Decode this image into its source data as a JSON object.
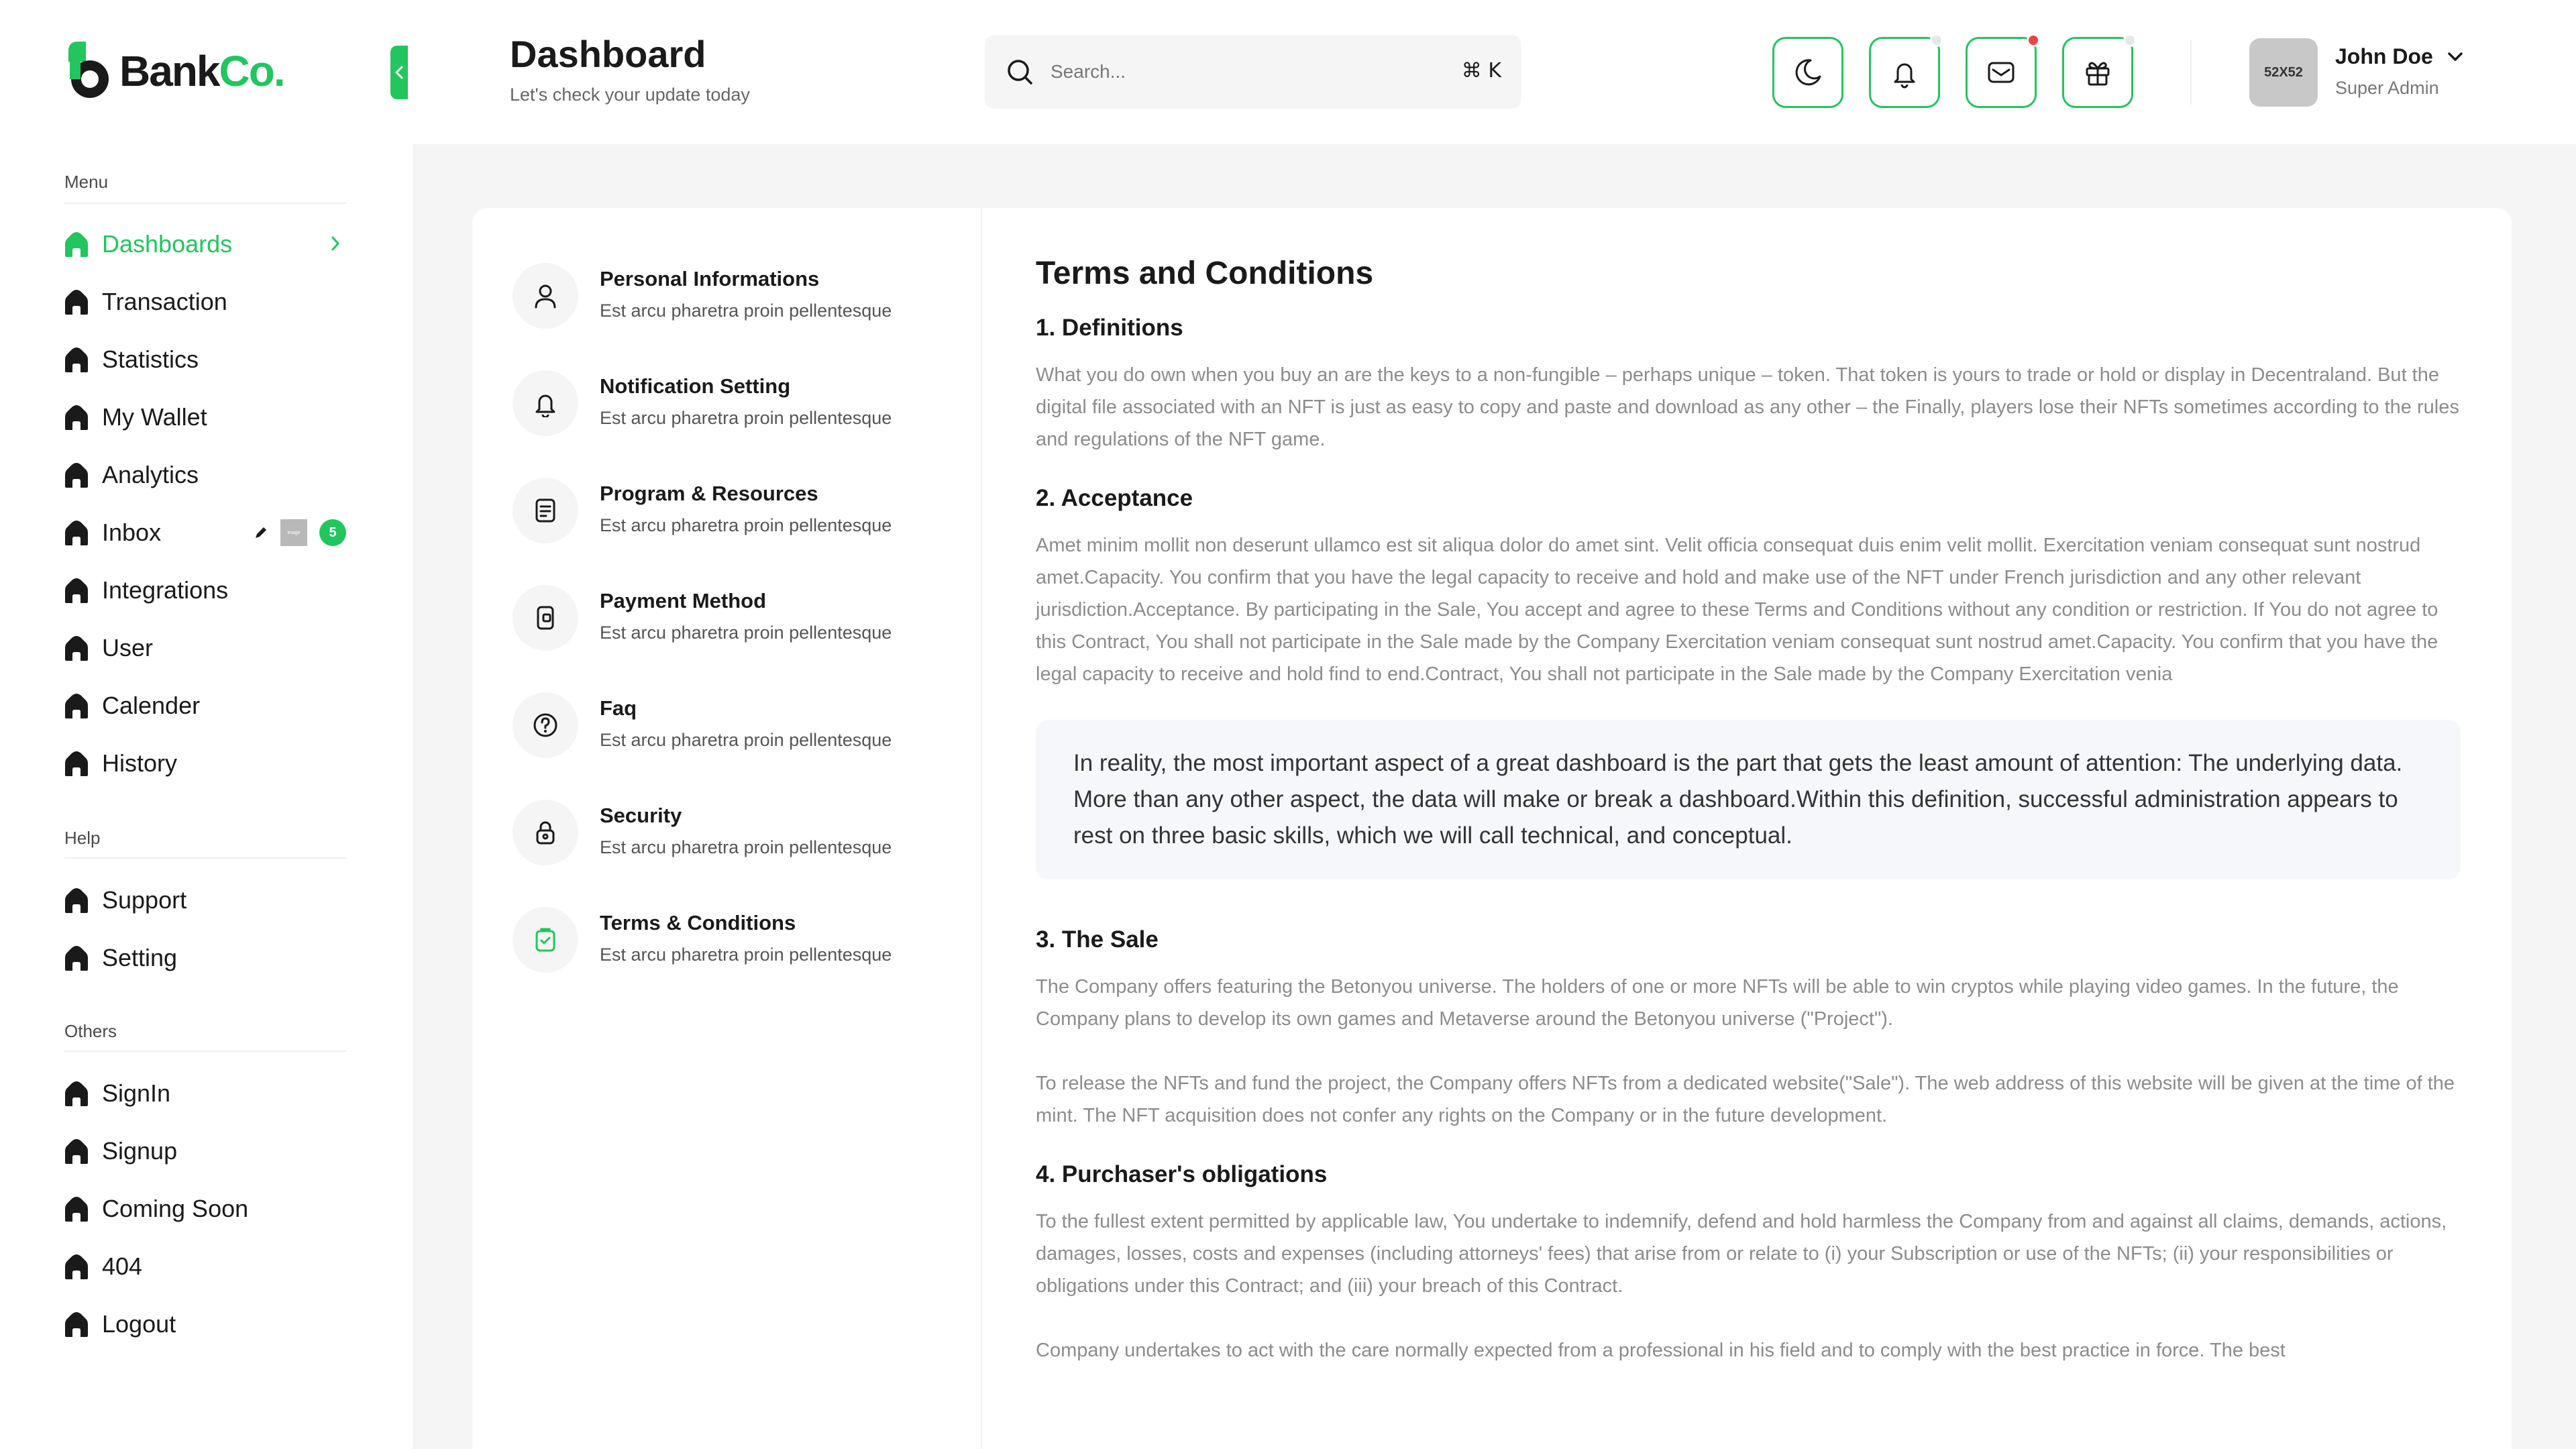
{
  "brand": {
    "name_part1": "Bank",
    "name_part2": "Co.",
    "accent": "#22c55e"
  },
  "header": {
    "title": "Dashboard",
    "subtitle": "Let's check your update today",
    "search": {
      "placeholder": "Search...",
      "shortcut": "⌘ K"
    },
    "actions": [
      {
        "icon": "moon-icon"
      },
      {
        "icon": "bell-icon",
        "dot_color": "#e5e7eb"
      },
      {
        "icon": "mail-icon",
        "dot_color": "#ef4444"
      },
      {
        "icon": "gift-icon",
        "dot_color": "#e5e7eb"
      }
    ],
    "user": {
      "avatar_text": "52X52",
      "name": "John Doe",
      "role": "Super Admin"
    }
  },
  "sidebar": {
    "menu_title": "Menu",
    "menu_items": [
      {
        "label": "Dashboards",
        "active": true
      },
      {
        "label": "Transaction"
      },
      {
        "label": "Statistics"
      },
      {
        "label": "My Wallet"
      },
      {
        "label": "Analytics"
      },
      {
        "label": "Inbox",
        "badge_image": "image",
        "badge_count": "5"
      },
      {
        "label": "Integrations"
      },
      {
        "label": "User"
      },
      {
        "label": "Calender"
      },
      {
        "label": "History"
      }
    ],
    "help_title": "Help",
    "help_items": [
      {
        "label": "Support"
      },
      {
        "label": "Setting"
      }
    ],
    "others_title": "Others",
    "others_items": [
      {
        "label": "SignIn"
      },
      {
        "label": "Signup"
      },
      {
        "label": "Coming Soon"
      },
      {
        "label": "404"
      },
      {
        "label": "Logout"
      }
    ]
  },
  "settings_nav": [
    {
      "title": "Personal Informations",
      "desc": "Est arcu pharetra proin pellentesque",
      "icon": "user-icon"
    },
    {
      "title": "Notification Setting",
      "desc": "Est arcu pharetra proin pellentesque",
      "icon": "bell-icon"
    },
    {
      "title": "Program & Resources",
      "desc": "Est arcu pharetra proin pellentesque",
      "icon": "document-icon"
    },
    {
      "title": "Payment Method",
      "desc": "Est arcu pharetra proin pellentesque",
      "icon": "wallet-icon"
    },
    {
      "title": "Faq",
      "desc": "Est arcu pharetra proin pellentesque",
      "icon": "question-icon"
    },
    {
      "title": "Security",
      "desc": "Est arcu pharetra proin pellentesque",
      "icon": "lock-icon"
    },
    {
      "title": "Terms & Conditions",
      "desc": "Est arcu pharetra proin pellentesque",
      "icon": "clipboard-check-icon",
      "active": true
    }
  ],
  "terms": {
    "title": "Terms and Conditions",
    "s1_heading": "1. Definitions",
    "s1_text": "What you do own when you buy an are the keys to a non-fungible – perhaps unique – token. That token is yours to trade or hold or display in Decentraland. But the digital file associated with an NFT is just as easy to copy and paste and download as any other – the Finally, players lose their NFTs sometimes according to the rules and regulations of the NFT game.",
    "s2_heading": "2. Acceptance",
    "s2_text": "Amet minim mollit non deserunt ullamco est sit aliqua dolor do amet sint. Velit officia consequat duis enim velit mollit. Exercitation veniam consequat sunt nostrud amet.Capacity. You confirm that you have the legal capacity to receive and hold and make use of the NFT under French jurisdiction and any other relevant jurisdiction.Acceptance. By participating in the Sale, You accept and agree to these Terms and Conditions without any condition or restriction. If You do not agree to this Contract, You shall not participate in the Sale made by the Company Exercitation veniam consequat sunt nostrud amet.Capacity. You confirm that you have the legal capacity to receive and hold find to end.Contract, You shall not participate in the Sale made by the Company Exercitation venia",
    "quote": "In reality, the most important aspect of a great dashboard is the part that gets the least amount of attention: The underlying data. More than any other aspect, the data will make or break a dashboard.Within this definition, successful administration appears to rest on three basic skills, which we will call technical, and conceptual.",
    "s3_heading": "3. The Sale",
    "s3_text_a": "The Company offers featuring the Betonyou universe. The holders of one or more NFTs will be able to win cryptos while playing video games. In the future, the Company plans to develop its own games and Metaverse around the Betonyou universe (\"Project\").",
    "s3_text_b": "To release the NFTs and fund the project, the Company offers NFTs from a dedicated website(\"Sale\"). The web address of this website will be given at the time of the mint. The NFT acquisition does not confer any rights on the Company or in the future development.",
    "s4_heading": "4. Purchaser's obligations",
    "s4_text_a": "To the fullest extent permitted by applicable law, You undertake to indemnify, defend and hold harmless the Company from and against all claims, demands, actions, damages, losses, costs and expenses (including attorneys' fees) that arise from or relate to (i) your Subscription or use of the NFTs; (ii) your responsibilities or obligations under this Contract; and (iii) your breach of this Contract.",
    "s4_text_b": "Company undertakes to act with the care normally expected from a professional in his field and to comply with the best practice in force. The best"
  }
}
